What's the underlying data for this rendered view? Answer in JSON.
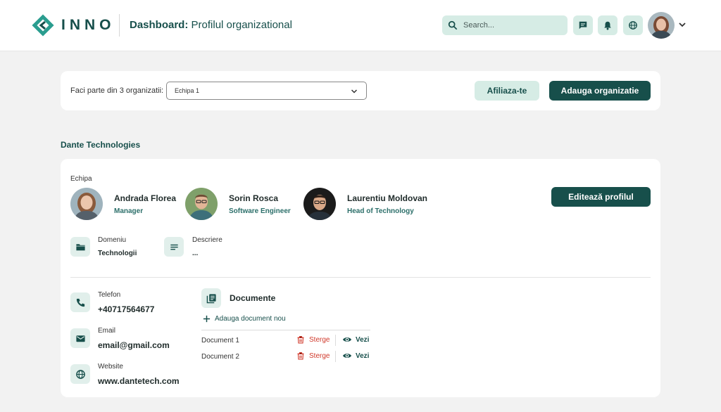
{
  "header": {
    "logo_text": "INNO",
    "title_bold": "Dashboard:",
    "title_rest": "Profilul organizational",
    "search_placeholder": "Search...",
    "icons": [
      "chat-icon",
      "bell-icon",
      "globe-icon",
      "chevron-down-icon"
    ]
  },
  "org_bar": {
    "label": "Faci parte din 3 organizatii:",
    "selected_team": "Echipa 1",
    "join_label": "Afiliaza-te",
    "add_label": "Adauga organizatie"
  },
  "organization": {
    "name": "Dante Technologies",
    "team_label": "Echipa",
    "members": [
      {
        "name": "Andrada Florea",
        "role": "Manager"
      },
      {
        "name": "Sorin Rosca",
        "role": "Software Engineer"
      },
      {
        "name": "Laurentiu Moldovan",
        "role": "Head of Technology"
      }
    ],
    "edit_label": "Editează profilul",
    "domain_label": "Domeniu",
    "domain_value": "Technologii",
    "description_label": "Descriere",
    "description_value": "...",
    "phone_label": "Telefon",
    "phone_value": "+40717564677",
    "email_label": "Email",
    "email_value": "email@gmail.com",
    "website_label": "Website",
    "website_value": "www.dantetech.com"
  },
  "documents": {
    "title": "Documente",
    "add_label": "Adauga document nou",
    "delete_label": "Sterge",
    "view_label": "Vezi",
    "items": [
      {
        "name": "Document 1"
      },
      {
        "name": "Document 2"
      }
    ]
  },
  "colors": {
    "primary": "#174f4b",
    "accent_light": "#d6ece5",
    "danger": "#d0392b",
    "background": "#f2f2f2"
  }
}
